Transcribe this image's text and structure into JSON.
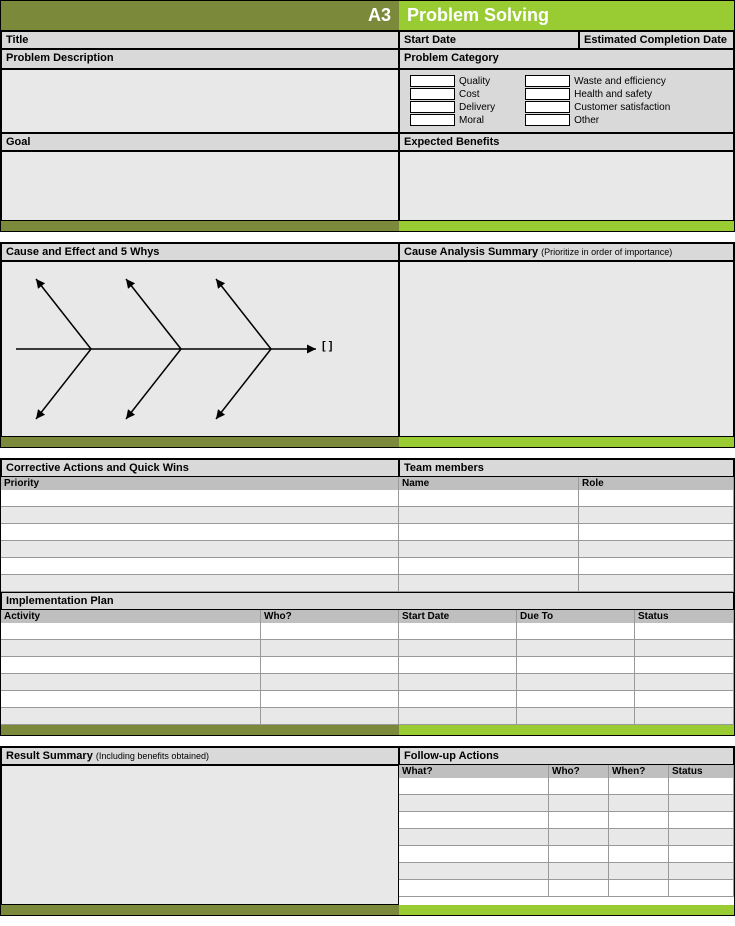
{
  "header": {
    "left": "A3",
    "right": "Problem Solving"
  },
  "section1": {
    "title_label": "Title",
    "start_date_label": "Start Date",
    "est_completion_label": "Estimated Completion Date",
    "problem_desc_label": "Problem Description",
    "problem_cat_label": "Problem Category",
    "categories_col1": [
      "Quality",
      "Cost",
      "Delivery",
      "Moral"
    ],
    "categories_col2": [
      "Waste and efficiency",
      "Health and safety",
      "Customer satisfaction",
      "Other"
    ],
    "goal_label": "Goal",
    "expected_benefits_label": "Expected Benefits"
  },
  "section2": {
    "cause_effect_label": "Cause and Effect and 5 Whys",
    "cause_analysis_label": "Cause Analysis Summary",
    "cause_analysis_note": "(Prioritize in order of importance)",
    "fishbone_head": "[       ]"
  },
  "section3": {
    "corrective_label": "Corrective Actions and Quick Wins",
    "team_label": "Team members",
    "priority_label": "Priority",
    "name_label": "Name",
    "role_label": "Role",
    "impl_plan_label": "Implementation Plan",
    "activity_label": "Activity",
    "who_label": "Who?",
    "start_date_label": "Start Date",
    "due_to_label": "Due To",
    "status_label": "Status"
  },
  "section4": {
    "result_summary_label": "Result Summary",
    "result_summary_note": "(Including benefits obtained)",
    "followup_label": "Follow-up Actions",
    "what_label": "What?",
    "who_label": "Who?",
    "when_label": "When?",
    "status_label": "Status"
  }
}
